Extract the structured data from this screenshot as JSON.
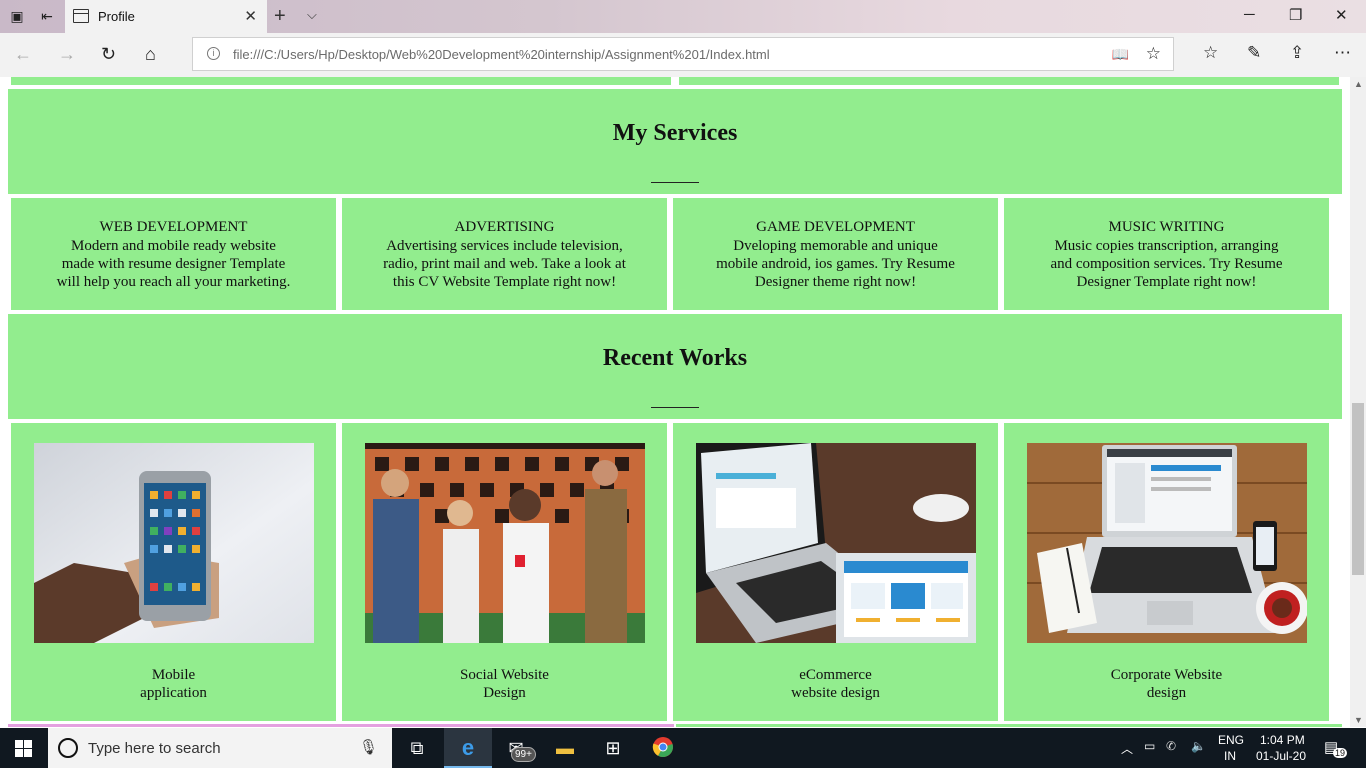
{
  "browser": {
    "tab_title": "Profile",
    "url": "file:///C:/Users/Hp/Desktop/Web%20Development%20internship/Assignment%201/Index.html"
  },
  "services": {
    "heading": "My Services",
    "cards": [
      {
        "title": "WEB DEVELOPMENT",
        "lines": [
          "Modern and mobile ready website",
          "made with resume designer Template",
          "will help you reach all your marketing."
        ]
      },
      {
        "title": "ADVERTISING",
        "lines": [
          "Advertising services include television,",
          "radio, print mail and web. Take a look at",
          "this CV Website Template right now!"
        ]
      },
      {
        "title": "GAME DEVELOPMENT",
        "lines": [
          "Dveloping memorable and unique",
          "mobile android, ios games. Try Resume",
          "Designer theme right now!"
        ]
      },
      {
        "title": "MUSIC WRITING",
        "lines": [
          "Music copies transcription, arranging",
          "and composition services. Try Resume",
          "Designer Template right now!"
        ]
      }
    ]
  },
  "works": {
    "heading": "Recent Works",
    "items": [
      {
        "caption": [
          "Mobile",
          "application"
        ]
      },
      {
        "caption": [
          "Social Website",
          "Design"
        ]
      },
      {
        "caption": [
          "eCommerce",
          "website design"
        ]
      },
      {
        "caption": [
          "Corporate Website",
          "design"
        ]
      }
    ]
  },
  "taskbar": {
    "search_placeholder": "Type here to search",
    "mail_badge": "99+",
    "lang_top": "ENG",
    "lang_bottom": "IN",
    "time": "1:04 PM",
    "date": "01-Jul-20",
    "notif_count": "19"
  },
  "colors": {
    "section_bg": "#92ed8e",
    "taskbar_bg": "#101820"
  }
}
